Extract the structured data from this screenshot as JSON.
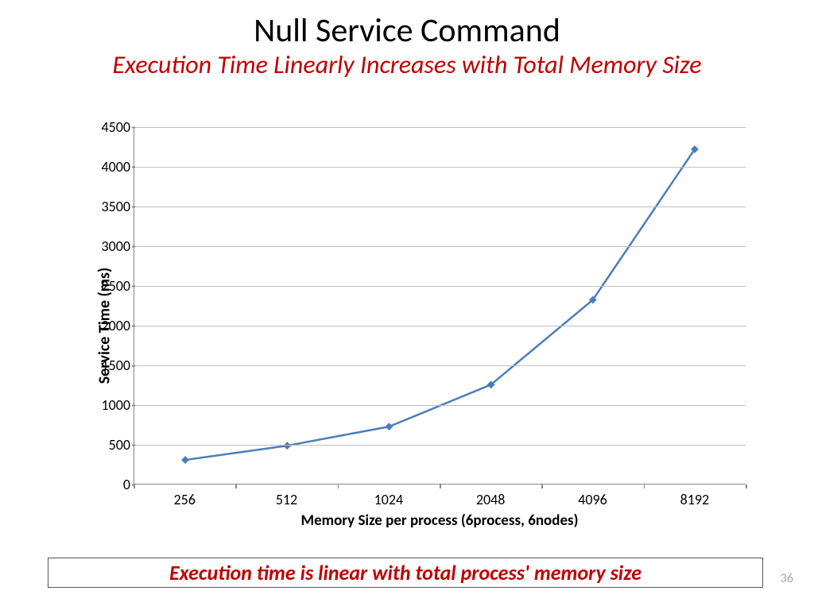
{
  "title": "Null Service Command",
  "subtitle": "Execution Time Linearly Increases with Total Memory Size",
  "caption": "Execution time is linear with total process' memory size",
  "page_number": "36",
  "chart_data": {
    "type": "line",
    "xlabel": "Memory Size per process (6process, 6nodes)",
    "ylabel": "Service Time (ms)",
    "categories": [
      "256",
      "512",
      "1024",
      "2048",
      "4096",
      "8192"
    ],
    "values": [
      300,
      480,
      720,
      1250,
      2320,
      4220
    ],
    "ylim": [
      0,
      4500
    ],
    "ytick_step": 500,
    "line_color": "#4a7ebb",
    "marker_color": "#4a7ebb"
  }
}
